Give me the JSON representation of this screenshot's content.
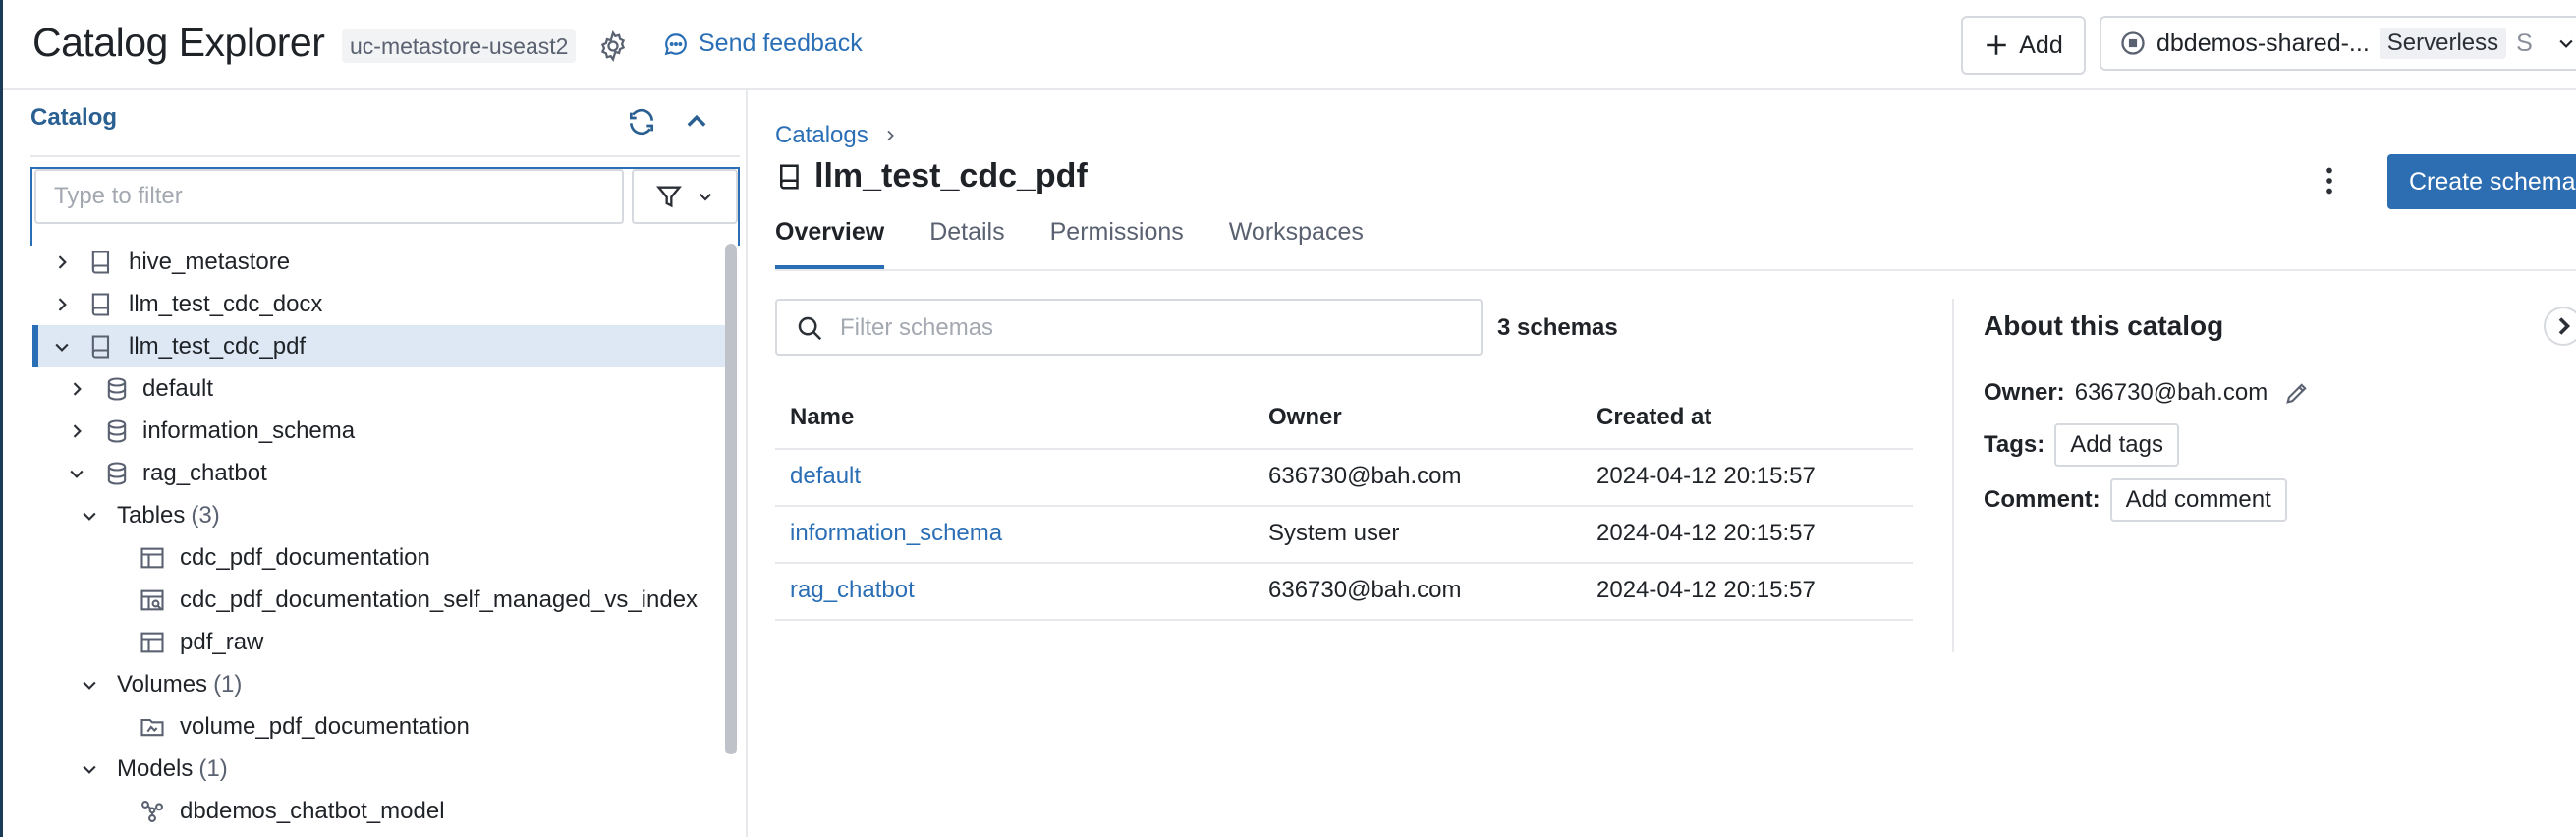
{
  "header": {
    "title": "Catalog Explorer",
    "metastore": "uc-metastore-useast2",
    "feedback_label": "Send feedback",
    "add_label": "Add",
    "compute_name": "dbdemos-shared-...",
    "compute_type": "Serverless",
    "compute_size": "S"
  },
  "sidebar": {
    "section_label": "Catalog",
    "filter_placeholder": "Type to filter",
    "tree": [
      {
        "label": "hive_metastore",
        "type": "catalog",
        "expanded": false
      },
      {
        "label": "llm_test_cdc_docx",
        "type": "catalog",
        "expanded": false
      },
      {
        "label": "llm_test_cdc_pdf",
        "type": "catalog",
        "expanded": true,
        "selected": true
      },
      {
        "label": "default",
        "type": "schema",
        "expanded": false
      },
      {
        "label": "information_schema",
        "type": "schema",
        "expanded": false
      },
      {
        "label": "rag_chatbot",
        "type": "schema",
        "expanded": true
      },
      {
        "label": "Tables",
        "count": "(3)",
        "type": "group"
      },
      {
        "label": "cdc_pdf_documentation",
        "type": "table"
      },
      {
        "label": "cdc_pdf_documentation_self_managed_vs_index",
        "type": "vector-index"
      },
      {
        "label": "pdf_raw",
        "type": "table"
      },
      {
        "label": "Volumes",
        "count": "(1)",
        "type": "group"
      },
      {
        "label": "volume_pdf_documentation",
        "type": "volume"
      },
      {
        "label": "Models",
        "count": "(1)",
        "type": "group"
      },
      {
        "label": "dbdemos_chatbot_model",
        "type": "model"
      }
    ]
  },
  "main": {
    "breadcrumb": "Catalogs",
    "title": "llm_test_cdc_pdf",
    "create_label": "Create schema",
    "tabs": [
      {
        "label": "Overview",
        "active": true
      },
      {
        "label": "Details",
        "active": false
      },
      {
        "label": "Permissions",
        "active": false
      },
      {
        "label": "Workspaces",
        "active": false
      }
    ],
    "filter_placeholder": "Filter schemas",
    "schema_count": "3 schemas",
    "table": {
      "headers": [
        "Name",
        "Owner",
        "Created at"
      ],
      "rows": [
        {
          "name": "default",
          "owner": "636730@bah.com",
          "created": "2024-04-12 20:15:57"
        },
        {
          "name": "information_schema",
          "owner": "System user",
          "created": "2024-04-12 20:15:57"
        },
        {
          "name": "rag_chatbot",
          "owner": "636730@bah.com",
          "created": "2024-04-12 20:15:57"
        }
      ]
    }
  },
  "about": {
    "title": "About this catalog",
    "owner_label": "Owner:",
    "owner_value": "636730@bah.com",
    "tags_label": "Tags:",
    "tags_button": "Add tags",
    "comment_label": "Comment:",
    "comment_button": "Add comment"
  },
  "colors": {
    "accent": "#2a6eb5",
    "primary_button": "#2d6db2",
    "selected_row": "#dde8f4"
  }
}
